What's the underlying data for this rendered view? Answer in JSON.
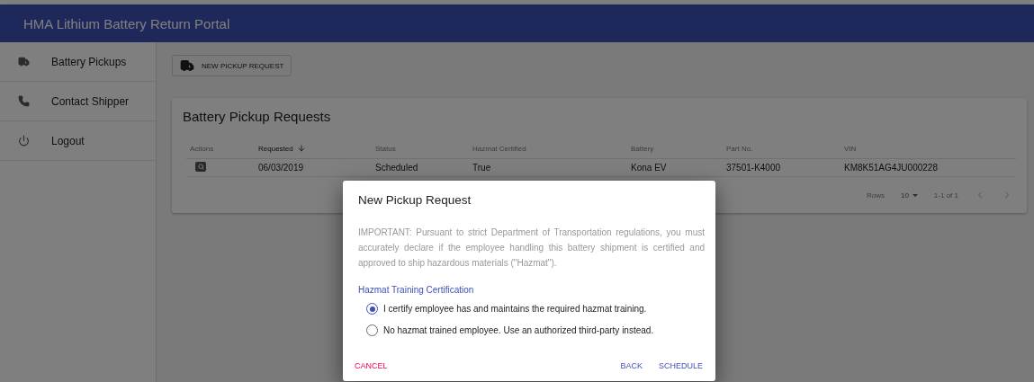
{
  "app_bar": {
    "title": "HMA Lithium Battery Return Portal"
  },
  "sidebar": {
    "items": [
      {
        "label": "Battery Pickups"
      },
      {
        "label": "Contact Shipper"
      },
      {
        "label": "Logout"
      }
    ]
  },
  "toolbar": {
    "new_button": "NEW PICKUP REQUEST"
  },
  "card": {
    "title": "Battery Pickup Requests"
  },
  "table": {
    "actions_header": "Actions",
    "columns": [
      {
        "label": "Requested",
        "sorted": true
      },
      {
        "label": "Status",
        "sorted": false
      },
      {
        "label": "Hazmat Certified",
        "sorted": false
      },
      {
        "label": "Battery",
        "sorted": false
      },
      {
        "label": "Part No.",
        "sorted": false
      },
      {
        "label": "VIN",
        "sorted": false
      }
    ],
    "rows": [
      {
        "cells": [
          "06/03/2019",
          "Scheduled",
          "True",
          "Kona EV",
          "37501-K4000",
          "KM8K51AG4JU000228"
        ]
      }
    ]
  },
  "pagination": {
    "rows_label": "Rows",
    "rows_per_page": "10",
    "range": "1-1 of 1"
  },
  "dialog": {
    "title": "New Pickup Request",
    "notice": "IMPORTANT: Pursuant to strict Department of Transportation regulations, you must accurately declare if the employee handling this battery shipment is certified and approved to ship hazardous materials (\"Hazmat\").",
    "group_label": "Hazmat Training Certification",
    "options": [
      {
        "label": "I certify employee has and maintains the required hazmat training.",
        "selected": true
      },
      {
        "label": "No hazmat trained employee. Use an authorized third-party instead.",
        "selected": false
      }
    ],
    "buttons": [
      {
        "label": "CANCEL",
        "kind": "danger"
      },
      {
        "label": "BACK",
        "kind": "primary"
      },
      {
        "label": "SCHEDULE",
        "kind": "primary"
      }
    ]
  }
}
